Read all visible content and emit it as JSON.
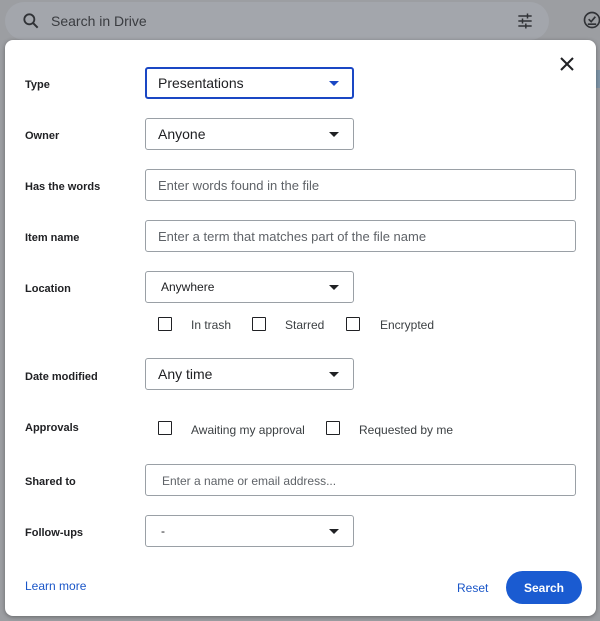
{
  "topbar": {
    "search_placeholder": "Search in Drive",
    "icons": [
      "search-icon",
      "tune-icon",
      "check-circle-icon"
    ]
  },
  "dialog": {
    "close_icon": "close-icon",
    "fields": {
      "type": {
        "label": "Type",
        "value": "Presentations"
      },
      "owner": {
        "label": "Owner",
        "value": "Anyone"
      },
      "has_words": {
        "label": "Has the words",
        "placeholder": "Enter words found in the file"
      },
      "item_name": {
        "label": "Item name",
        "placeholder": "Enter a term that matches part of the file name"
      },
      "location": {
        "label": "Location",
        "value": "Anywhere",
        "checkboxes": [
          {
            "label": "In trash",
            "checked": false
          },
          {
            "label": "Starred",
            "checked": false
          },
          {
            "label": "Encrypted",
            "checked": false
          }
        ]
      },
      "date_modified": {
        "label": "Date modified",
        "value": "Any time"
      },
      "approvals": {
        "label": "Approvals",
        "checkboxes": [
          {
            "label": "Awaiting my approval",
            "checked": false
          },
          {
            "label": "Requested by me",
            "checked": false
          }
        ]
      },
      "shared_to": {
        "label": "Shared to",
        "placeholder": "Enter a name or email address..."
      },
      "follow_ups": {
        "label": "Follow-ups",
        "value": "-"
      }
    },
    "footer": {
      "learn_more": "Learn more",
      "reset": "Reset",
      "search": "Search"
    }
  },
  "colors": {
    "accent": "#1a5bd1",
    "focus_border": "#1a47c4",
    "overlay": "#9c9ea2"
  }
}
